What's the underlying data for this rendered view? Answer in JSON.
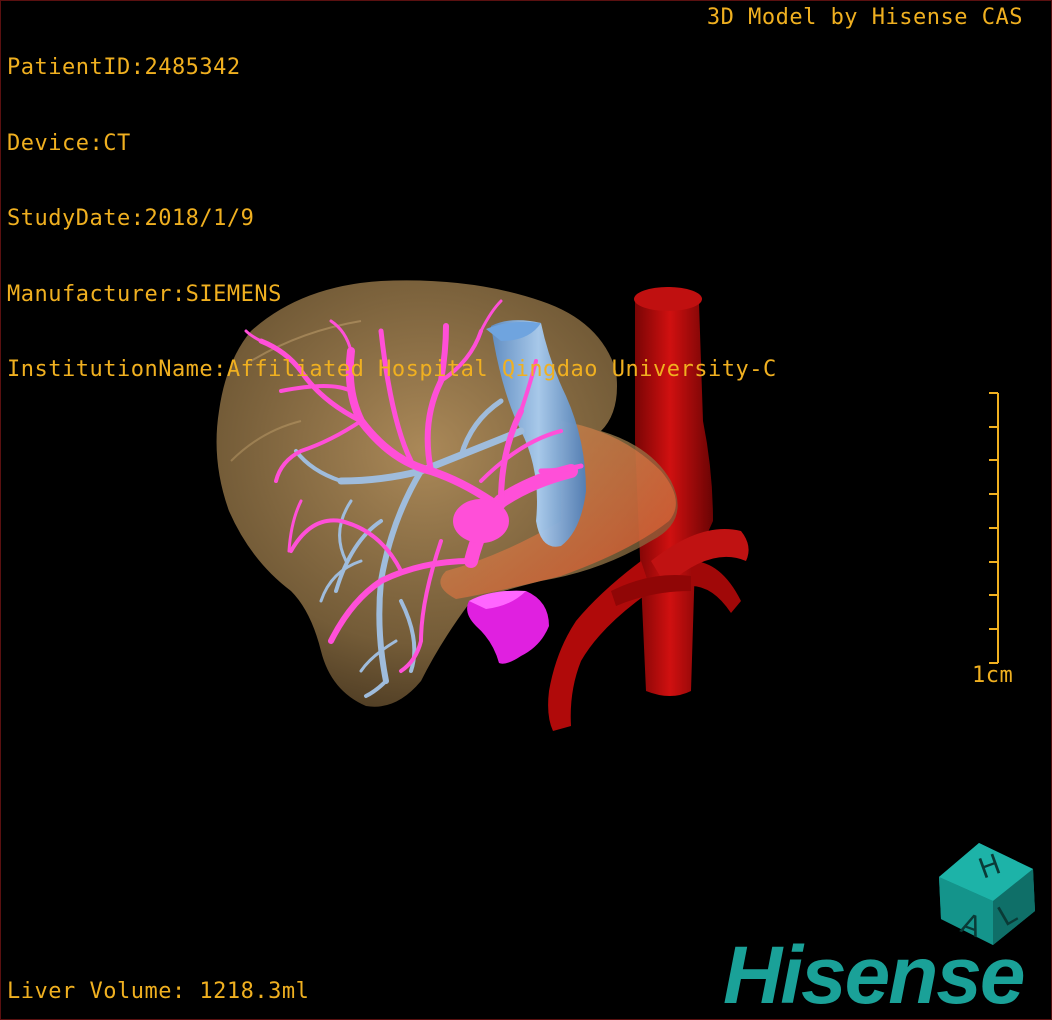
{
  "overlay": {
    "patient_id": "PatientID:2485342",
    "device": "Device:CT",
    "study_date": "StudyDate:2018/1/9",
    "manufacturer": "Manufacturer:SIEMENS",
    "institution": "InstitutionName:Affiliated Hospital Qingdao University-C",
    "credit": "3D Model by Hisense CAS",
    "liver_volume": "Liver Volume: 1218.3ml",
    "scale_label": "1cm"
  },
  "brand": {
    "logo_text": "Hisense",
    "cube_letters": [
      "H",
      "A",
      "L"
    ]
  },
  "model": {
    "structures": [
      {
        "name": "liver",
        "color": "#b8935a"
      },
      {
        "name": "portal-vein",
        "color": "#ff4fd8"
      },
      {
        "name": "hepatic-vein",
        "color": "#9fbcdc"
      },
      {
        "name": "inferior-vena-cava",
        "color": "#7fb2e6"
      },
      {
        "name": "aorta",
        "color": "#b00a0a"
      },
      {
        "name": "tumor",
        "color": "#e020e0"
      }
    ]
  },
  "colors": {
    "overlay_text": "#f0b020",
    "brand": "#1aa198",
    "background": "#000000"
  }
}
